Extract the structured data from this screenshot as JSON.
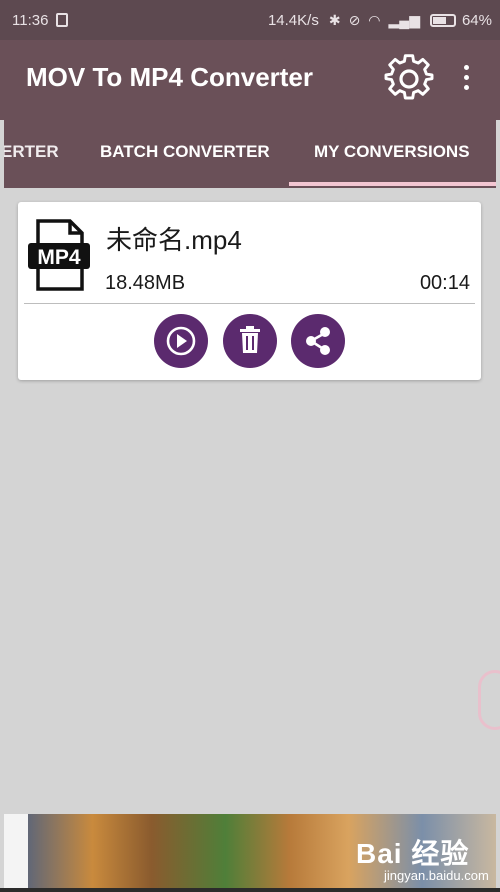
{
  "status_bar": {
    "time": "11:36",
    "net_speed": "14.4K/s",
    "battery": "64%",
    "icons": [
      "sim-icon",
      "bluetooth-icon",
      "alarm-off-icon",
      "wifi-icon",
      "signal-icon",
      "battery-icon"
    ]
  },
  "toolbar": {
    "title": "MOV To MP4 Converter",
    "settings_icon": "gear-icon",
    "overflow_icon": "more-vert-icon"
  },
  "tabs": [
    {
      "label": "ERTER",
      "selected": false
    },
    {
      "label": "BATCH CONVERTER",
      "selected": false
    },
    {
      "label": "MY CONVERSIONS",
      "selected": true
    }
  ],
  "conversions": [
    {
      "icon_label": "MP4",
      "name": "未命名.mp4",
      "size": "18.48MB",
      "duration": "00:14",
      "actions": [
        "play-icon",
        "delete-icon",
        "share-icon"
      ]
    }
  ],
  "watermark": {
    "brand": "Bai 经验",
    "url": "jingyan.baidu.com"
  },
  "colors": {
    "status_bar": "#5d4950",
    "toolbar": "#6a5058",
    "tab_indicator": "#f3c6d2",
    "action_button": "#5b2a6e",
    "background": "#d4d4d4"
  }
}
